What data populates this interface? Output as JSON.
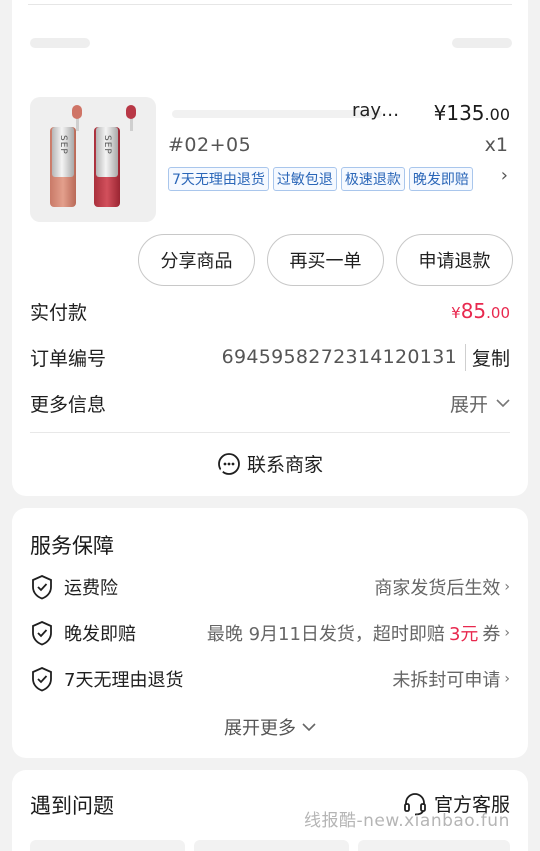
{
  "product": {
    "title": "ray…",
    "price_symbol": "¥",
    "price_int": "135",
    "price_dec": ".00",
    "spec": "#02+05",
    "qty": "x1",
    "tags": [
      "7天无理由退货",
      "过敏包退",
      "极速退款",
      "晚发即赔"
    ],
    "image_text": "SEP"
  },
  "actions": {
    "share": "分享商品",
    "rebuy": "再买一单",
    "refund": "申请退款"
  },
  "order": {
    "paid_label": "实付款",
    "paid_symbol": "¥",
    "paid_int": "85",
    "paid_dec": ".00",
    "order_no_label": "订单编号",
    "order_no": "6945958272314120131",
    "copy": "复制",
    "more_info_label": "更多信息",
    "expand": "展开",
    "contact": "联系商家"
  },
  "service": {
    "title": "服务保障",
    "items": [
      {
        "name": "运费险",
        "desc": "商家发货后生效"
      },
      {
        "name": "晚发即赔",
        "desc_prefix": "最晚 9月11日发货，超时即赔",
        "desc_amount": "3元",
        "desc_suffix": "券"
      },
      {
        "name": "7天无理由退货",
        "desc": "未拆封可申请"
      }
    ],
    "more": "展开更多"
  },
  "issues": {
    "title": "遇到问题",
    "support": "官方客服"
  },
  "watermark": "线报酷-new.xianbao.fun",
  "colors": {
    "accent_red": "#e8284e",
    "tag_blue": "#2a66b8",
    "background": "#f2f2f2"
  }
}
